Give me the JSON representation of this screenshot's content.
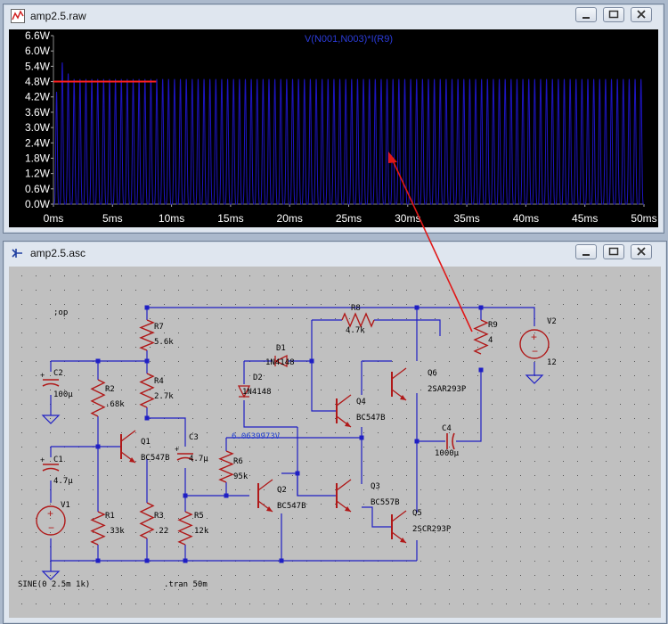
{
  "plot_window": {
    "title": "amp2.5.raw",
    "trace_label": "V(N001,N003)*I(R9)",
    "colors": {
      "background": "#000000",
      "trace": "#1d14c0",
      "axis_text": "#ffffff",
      "cursor": "#ff2020",
      "label": "#2b3bd9"
    }
  },
  "chart_data": {
    "type": "line",
    "xlabel": "",
    "ylabel": "",
    "xlim": [
      0,
      50
    ],
    "ylim": [
      0,
      6.6
    ],
    "x_ticks": [
      "0ms",
      "5ms",
      "10ms",
      "15ms",
      "20ms",
      "25ms",
      "30ms",
      "35ms",
      "40ms",
      "45ms",
      "50ms"
    ],
    "y_ticks": [
      "0.0W",
      "0.6W",
      "1.2W",
      "1.8W",
      "2.4W",
      "3.0W",
      "3.6W",
      "4.2W",
      "4.8W",
      "5.4W",
      "6.0W",
      "6.6W"
    ],
    "series": [
      {
        "name": "V(N001,N003)*I(R9)",
        "frequency_khz": 2,
        "peak_w": 4.9,
        "initial_peak_w": 6.2,
        "trough_w": 0.0,
        "unit": "W"
      }
    ],
    "cursor_marker": {
      "y": 4.8,
      "x_from": 0,
      "x_to": 8.7
    },
    "grid": false,
    "legend": "none"
  },
  "schematic_window": {
    "title": "amp2.5.asc",
    "directives": {
      "op": ";op",
      "source": "SINE(0 2.5m 1k)",
      "tran": ".tran 50m"
    },
    "node_voltage": "6.0639973V",
    "components": [
      {
        "ref": "R7",
        "value": "5.6k"
      },
      {
        "ref": "R4",
        "value": "2.7k"
      },
      {
        "ref": "R2",
        "value": ".68k"
      },
      {
        "ref": "C2",
        "value": "100µ"
      },
      {
        "ref": "Q1",
        "value": "BC547B"
      },
      {
        "ref": "C3",
        "value": "4.7µ"
      },
      {
        "ref": "C1",
        "value": "4.7µ"
      },
      {
        "ref": "V1",
        "value": ""
      },
      {
        "ref": "R1",
        "value": ".33k"
      },
      {
        "ref": "R3",
        "value": ".22"
      },
      {
        "ref": "R5",
        "value": "12k"
      },
      {
        "ref": "R6",
        "value": "95k"
      },
      {
        "ref": "Q2",
        "value": "BC547B"
      },
      {
        "ref": "D1",
        "value": "1N4148"
      },
      {
        "ref": "D2",
        "value": "1N4148"
      },
      {
        "ref": "R8",
        "value": "4.7k"
      },
      {
        "ref": "Q4",
        "value": "BC547B"
      },
      {
        "ref": "Q3",
        "value": "BC557B"
      },
      {
        "ref": "Q6",
        "value": "2SAR293P"
      },
      {
        "ref": "Q5",
        "value": "2SCR293P"
      },
      {
        "ref": "C4",
        "value": "1000µ"
      },
      {
        "ref": "R9",
        "value": "4"
      },
      {
        "ref": "V2",
        "value": "12"
      }
    ],
    "colors": {
      "background": "#c0c0c0",
      "wire": "#1f1fc4",
      "component": "#b01818",
      "text": "#000000",
      "dot": "#555555",
      "node_voltage": "#2040d0"
    }
  },
  "window_controls": {
    "minimize": "minimize-icon",
    "maximize": "maximize-icon",
    "close": "close-icon"
  }
}
